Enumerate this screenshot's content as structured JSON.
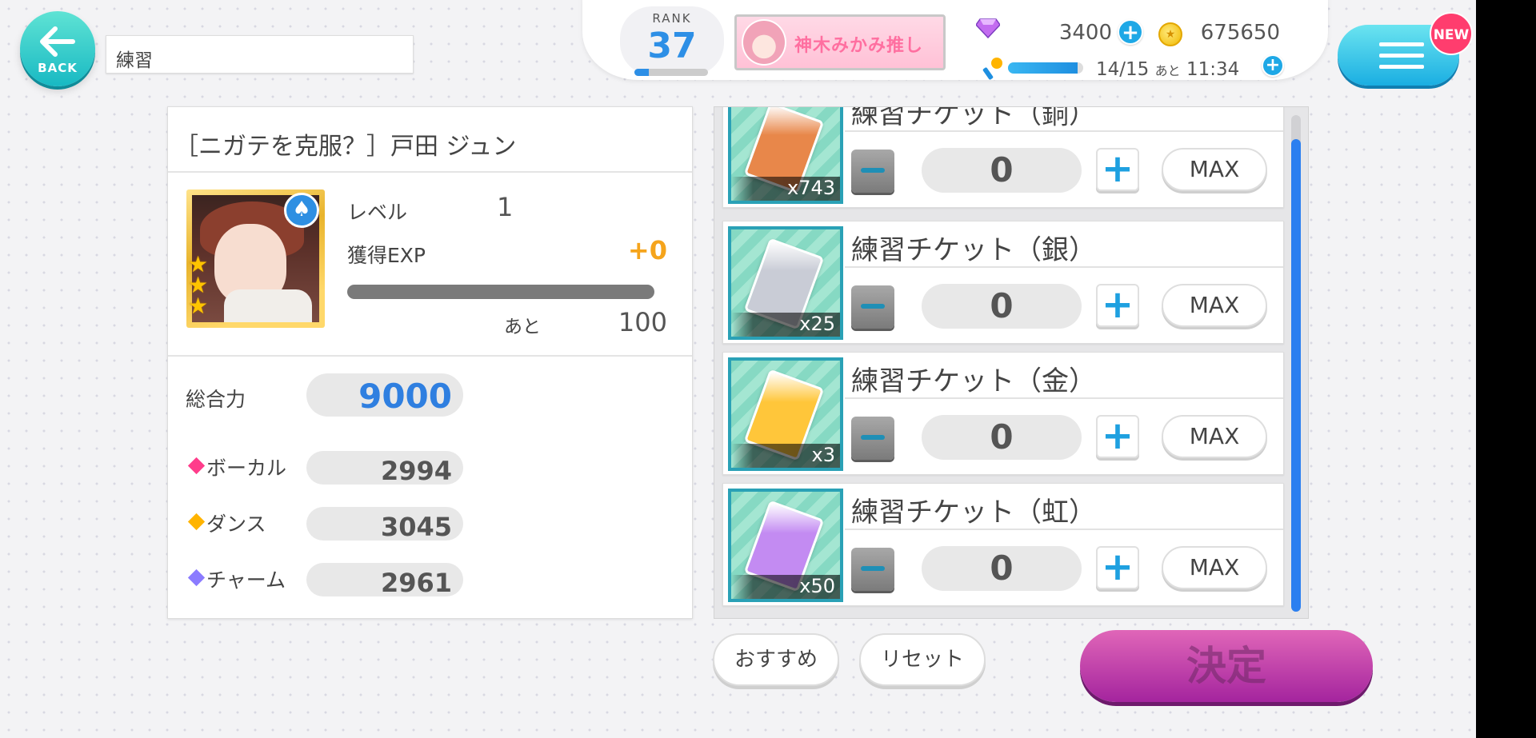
{
  "header": {
    "back_label": "BACK",
    "screen_title": "練習",
    "rank_label": "RANK",
    "rank_value": "37",
    "oshi_text": "神木みかみ推し",
    "gems": "3400",
    "coins": "675650",
    "stamina": "14/15",
    "stamina_time_prefix": "あと",
    "stamina_time": "11:34",
    "new_badge": "NEW"
  },
  "card": {
    "title": "［ニガテを克服？］戸田 ジュン",
    "level_label": "レベル",
    "level_value": "1",
    "exp_label": "獲得EXP",
    "exp_gain": "+0",
    "remaining_label": "あと",
    "remaining_value": "100",
    "total_label": "総合力",
    "total_value": "9000",
    "stats": [
      {
        "label": "ボーカル",
        "value": "2994",
        "color": "#ff3d8b"
      },
      {
        "label": "ダンス",
        "value": "3045",
        "color": "#ffb400"
      },
      {
        "label": "チャーム",
        "value": "2961",
        "color": "#8b7bff"
      }
    ]
  },
  "tickets": [
    {
      "name": "練習チケット（銅）",
      "count": "x743",
      "qty": "0",
      "max_label": "MAX",
      "color": "#e8874a"
    },
    {
      "name": "練習チケット（銀）",
      "count": "x25",
      "qty": "0",
      "max_label": "MAX",
      "color": "#c9ccd6"
    },
    {
      "name": "練習チケット（金）",
      "count": "x3",
      "qty": "0",
      "max_label": "MAX",
      "color": "#ffc63a"
    },
    {
      "name": "練習チケット（虹）",
      "count": "x50",
      "qty": "0",
      "max_label": "MAX",
      "color": "#c38bf2"
    }
  ],
  "footer": {
    "recommend_label": "おすすめ",
    "reset_label": "リセット",
    "confirm_label": "決定"
  }
}
